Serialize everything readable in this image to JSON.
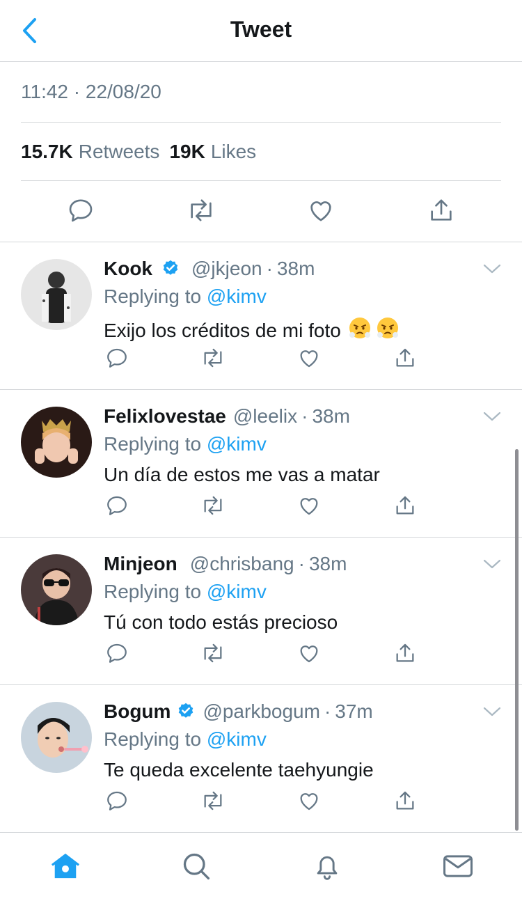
{
  "header": {
    "title": "Tweet",
    "back_icon": "chevron-left-icon"
  },
  "tweet": {
    "timestamp": "11:42 · 22/08/20",
    "retweets_count": "15.7K",
    "retweets_label": "Retweets",
    "likes_count": "19K",
    "likes_label": "Likes"
  },
  "replies": [
    {
      "name": "Kook",
      "verified": true,
      "handle": "@jkjeon",
      "dot": "·",
      "time": "38m",
      "replying_prefix": "Replying to",
      "replying_to": "@kimv",
      "text": "Exijo los créditos de mi foto",
      "emoji": "face-with-steam-from-nose",
      "avatar_color": "#9a9a9a"
    },
    {
      "name": "Felixlovestae",
      "verified": false,
      "handle": "@leelix",
      "dot": "·",
      "time": "38m",
      "replying_prefix": "Replying to",
      "replying_to": "@kimv",
      "text": "Un día de estos me vas a matar",
      "avatar_color": "#6b4a3a"
    },
    {
      "name": "Minjeon",
      "verified": false,
      "handle": "@chrisbang",
      "dot": "·",
      "time": "38m",
      "replying_prefix": "Replying to",
      "replying_to": "@kimv",
      "text": "Tú con todo estás precioso",
      "avatar_color": "#5a4a4a"
    },
    {
      "name": "Bogum",
      "verified": true,
      "handle": "@parkbogum",
      "dot": "·",
      "time": "37m",
      "replying_prefix": "Replying to",
      "replying_to": "@kimv",
      "text": "Te queda excelente taehyungie",
      "avatar_color": "#a8b4c0"
    }
  ],
  "tabbar": {
    "tabs": [
      {
        "icon": "home-icon",
        "active": true
      },
      {
        "icon": "search-icon",
        "active": false
      },
      {
        "icon": "notifications-icon",
        "active": false
      },
      {
        "icon": "messages-icon",
        "active": false
      }
    ]
  },
  "colors": {
    "accent": "#1da1f2",
    "secondary_text": "#657786",
    "primary_text": "#14171a",
    "divider": "#d3d6d9",
    "icon_gray": "#657786"
  }
}
